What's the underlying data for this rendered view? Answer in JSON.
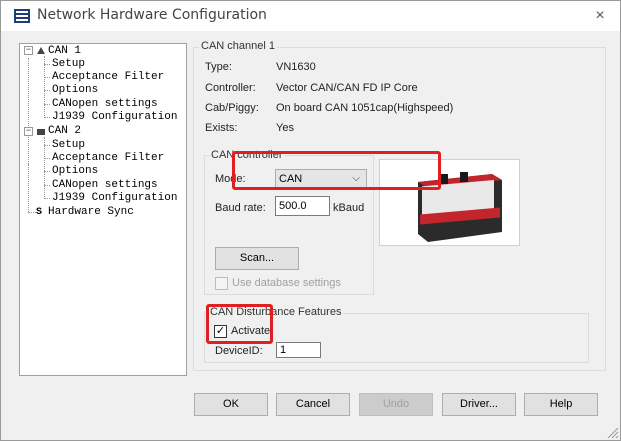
{
  "window": {
    "title": "Network Hardware Configuration"
  },
  "tree": {
    "items": [
      {
        "label": "CAN 1"
      },
      {
        "label": "Setup"
      },
      {
        "label": "Acceptance Filter"
      },
      {
        "label": "Options"
      },
      {
        "label": "CANopen settings"
      },
      {
        "label": "J1939 Configuration"
      },
      {
        "label": "CAN 2"
      },
      {
        "label": "Setup"
      },
      {
        "label": "Acceptance Filter"
      },
      {
        "label": "Options"
      },
      {
        "label": "CANopen settings"
      },
      {
        "label": "J1939 Configuration"
      },
      {
        "label": "Hardware Sync"
      }
    ]
  },
  "channel": {
    "group_title": "CAN channel 1",
    "type_label": "Type:",
    "type_value": "VN1630",
    "controller_label": "Controller:",
    "controller_value": "Vector CAN/CAN FD IP Core",
    "cab_label": "Cab/Piggy:",
    "cab_value": "On board CAN 1051cap(Highspeed)",
    "exists_label": "Exists:",
    "exists_value": "Yes"
  },
  "can_controller": {
    "group_title": "CAN controller",
    "mode_label": "Mode:",
    "mode_value": "CAN",
    "baud_label": "Baud rate:",
    "baud_value": "500.0",
    "baud_unit": "kBaud",
    "scan_button": "Scan...",
    "use_db_label": "Use database settings"
  },
  "disturbance": {
    "group_title": "CAN Disturbance Features",
    "activate_label": "Activate",
    "activate_checked": "✓",
    "device_id_label": "DeviceID:",
    "device_id_value": "1"
  },
  "buttons": {
    "ok": "OK",
    "cancel": "Cancel",
    "undo": "Undo",
    "driver": "Driver...",
    "help": "Help"
  },
  "icons": {
    "close": "×",
    "dropdown": "⌵",
    "expander": "−"
  },
  "colors": {
    "highlight": "#e02020"
  }
}
